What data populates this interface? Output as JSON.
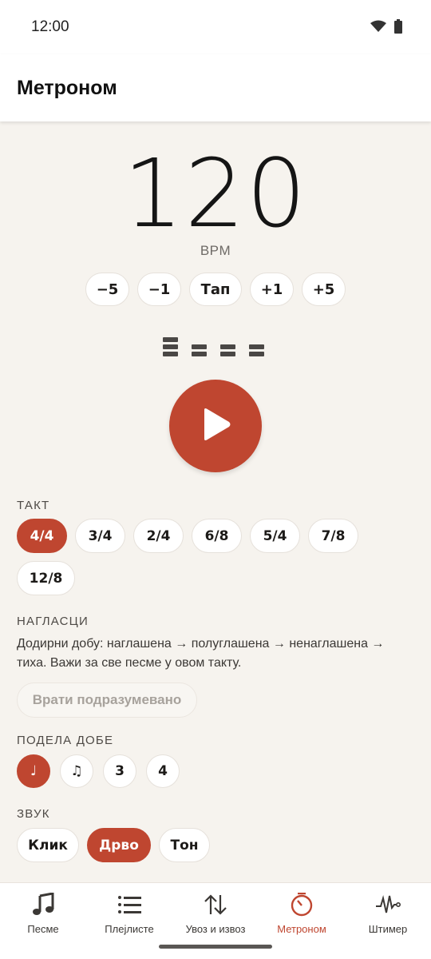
{
  "status_bar": {
    "time": "12:00",
    "icons": [
      "wifi-icon",
      "battery-icon"
    ]
  },
  "app_bar": {
    "title": "Метроном"
  },
  "tempo": {
    "bpm": "120",
    "unit": "BPM",
    "buttons": [
      {
        "label": "−5"
      },
      {
        "label": "−1"
      },
      {
        "label": "Тап"
      },
      {
        "label": "+1"
      },
      {
        "label": "+5"
      }
    ]
  },
  "beats_indicator": {
    "levels": [
      "accented",
      "half",
      "half",
      "half"
    ]
  },
  "play": {
    "icon": "play-icon",
    "state": "stopped"
  },
  "time_signature": {
    "label": "ТАКТ",
    "options": [
      "4/4",
      "3/4",
      "2/4",
      "6/8",
      "5/4",
      "7/8",
      "12/8"
    ],
    "selected": "4/4"
  },
  "accents": {
    "label": "НАГЛАСЦИ",
    "hint": "Додирни добу: наглашена → полуглашена → ненаглашена → тиха. Важи за све песме у овом такту.",
    "reset_label": "Врати подразумевано"
  },
  "subdivision": {
    "label": "ПОДЕЛА ДОБЕ",
    "options": [
      "♩",
      "♫",
      "3",
      "4"
    ],
    "selected": "♩"
  },
  "sound": {
    "label": "ЗВУК",
    "options": [
      "Клик",
      "Дрво",
      "Тон"
    ],
    "selected": "Дрво"
  },
  "bottom_nav": {
    "items": [
      {
        "label": "Песме",
        "icon": "music-note-icon"
      },
      {
        "label": "Плејлисте",
        "icon": "list-icon"
      },
      {
        "label": "Увоз и извоз",
        "icon": "import-export-icon"
      },
      {
        "label": "Метроном",
        "icon": "timer-icon",
        "active": true
      },
      {
        "label": "Штимер",
        "icon": "waveform-icon"
      }
    ]
  },
  "colors": {
    "accent": "#bf4630",
    "background": "#f6f3ee",
    "surface": "#ffffff"
  }
}
